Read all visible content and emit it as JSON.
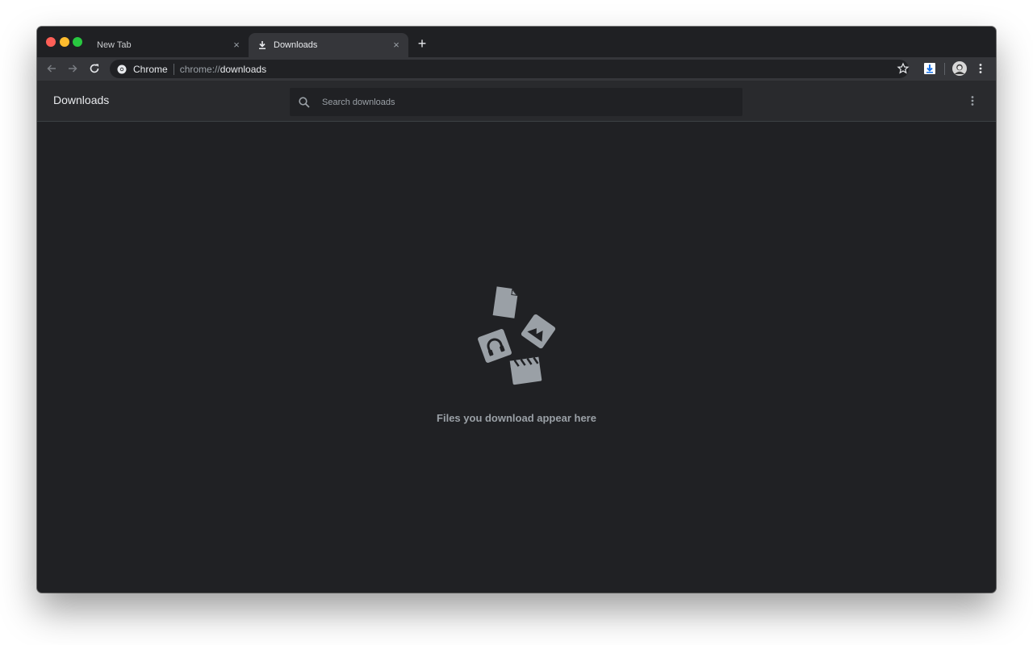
{
  "tabs": [
    {
      "title": "New Tab",
      "active": false
    },
    {
      "title": "Downloads",
      "active": true
    }
  ],
  "omnibox": {
    "site_label": "Chrome",
    "url_scheme": "chrome://",
    "url_host": "downloads"
  },
  "page": {
    "title": "Downloads",
    "search_placeholder": "Search downloads",
    "empty_message": "Files you download appear here"
  },
  "icons": {
    "close": "×",
    "new_tab": "+"
  },
  "colors": {
    "background": "#202124",
    "header": "#292a2d",
    "toolbar": "#35363a",
    "text_primary": "#e8eaed",
    "text_secondary": "#9aa0a6",
    "accent": "#1a73e8"
  }
}
